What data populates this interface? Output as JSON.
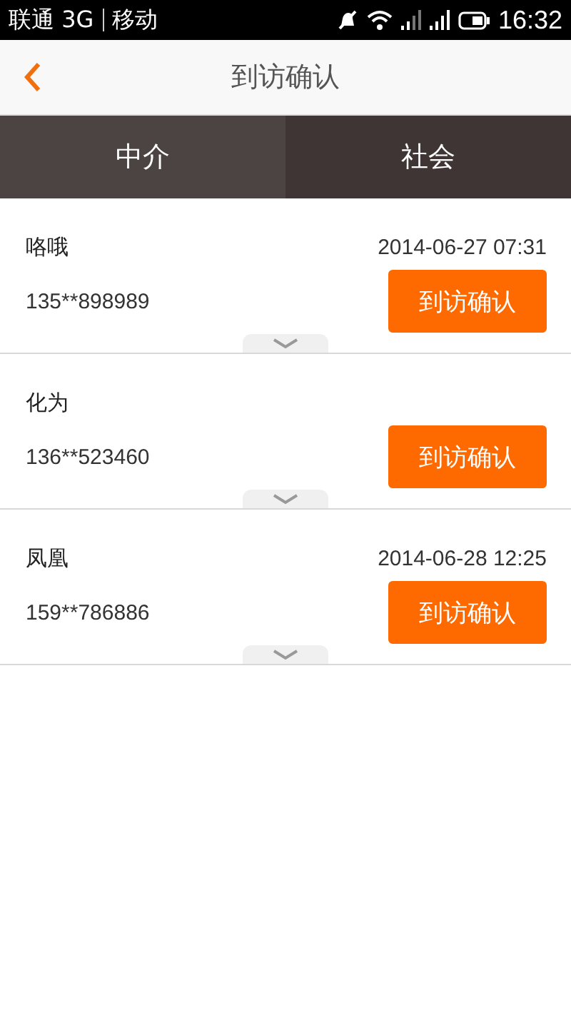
{
  "status_bar": {
    "carrier": "联通 3G",
    "carrier_2": "移动",
    "time": "16:32"
  },
  "header": {
    "title": "到访确认"
  },
  "tabs": [
    {
      "label": "中介",
      "selected": true
    },
    {
      "label": "社会",
      "selected": false
    }
  ],
  "visits": [
    {
      "name": "咯哦",
      "date": "2014-06-27 07:31",
      "phone": "135**898989",
      "button": "到访确认"
    },
    {
      "name": "化为",
      "phone": "136**523460",
      "button": "到访确认"
    },
    {
      "name": "凤凰",
      "date": "2014-06-28 12:25",
      "phone": "159**786886",
      "button": "到访确认"
    }
  ]
}
